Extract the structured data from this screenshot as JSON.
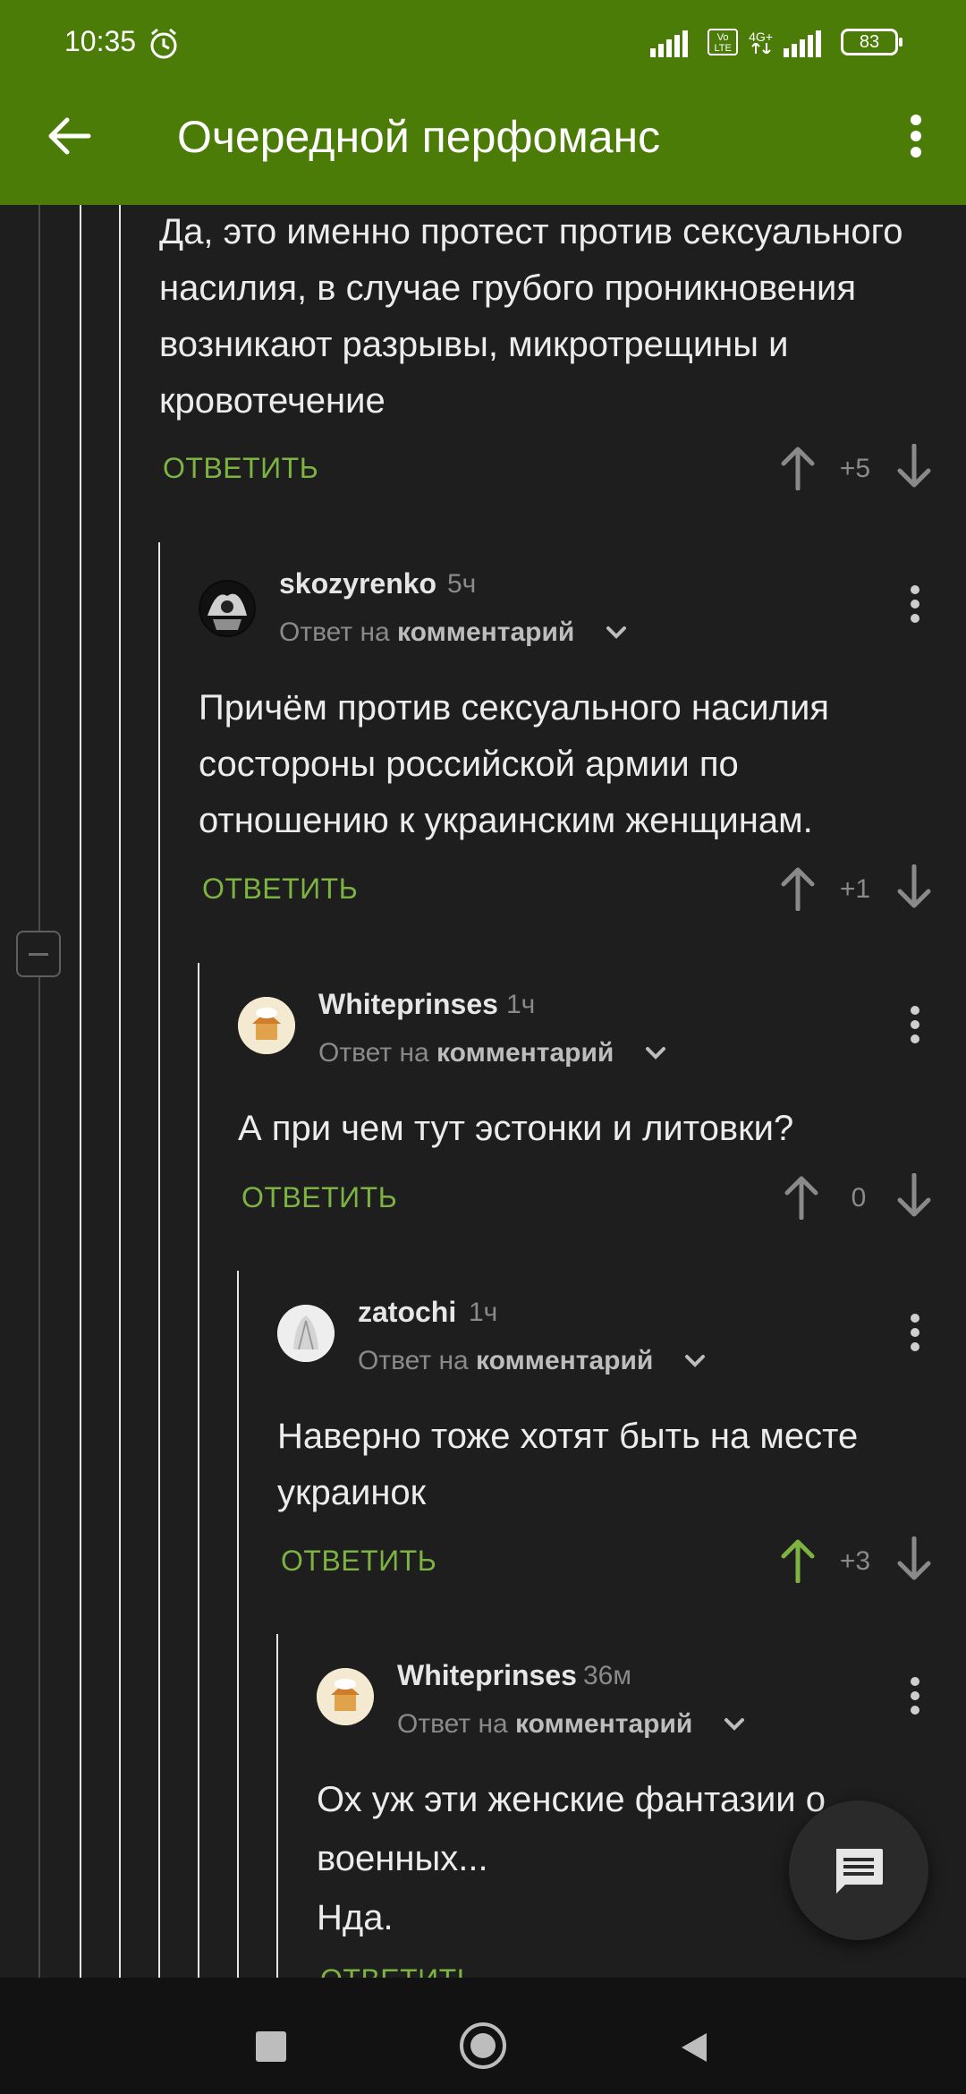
{
  "status": {
    "time": "10:35",
    "battery": "83",
    "volte": "Vo\nLTE",
    "net": "4G+"
  },
  "app_bar": {
    "title": "Очередной перфоманс"
  },
  "comments": [
    {
      "id": "c0",
      "body": "Да, это именно протест против сексуального насилия, в случае грубого проникновения возникают разрывы, микротрещины и кровотечение",
      "reply_label": "ОТВЕТИТЬ",
      "score": "+5",
      "upvoted": false
    },
    {
      "id": "c1",
      "username": "skozyrenko",
      "time": "5ч",
      "reply_prefix": "Ответ на",
      "reply_target": "комментарий",
      "body": "Причём против сексуального насилия состороны российской армии по отношению к украинским женщинам.",
      "reply_label": "ОТВЕТИТЬ",
      "score": "+1",
      "upvoted": false
    },
    {
      "id": "c2",
      "username": "Whiteprinses",
      "time": "1ч",
      "reply_prefix": "Ответ на",
      "reply_target": "комментарий",
      "body": "А при чем тут эстонки и литовки?",
      "reply_label": "ОТВЕТИТЬ",
      "score": "0",
      "upvoted": false
    },
    {
      "id": "c3",
      "username": "zatochi",
      "time": "1ч",
      "reply_prefix": "Ответ на",
      "reply_target": "комментарий",
      "body": "Наверно тоже хотят быть на месте украинок",
      "reply_label": "ОТВЕТИТЬ",
      "score": "+3",
      "upvoted": true
    },
    {
      "id": "c4",
      "username": "Whiteprinses",
      "time": "36м",
      "reply_prefix": "Ответ на",
      "reply_target": "комментарий",
      "body_lines": [
        "Ох уж эти женские фантазии о",
        "военных...",
        "Нда."
      ],
      "reply_label": "ОТВЕТИТЬ"
    }
  ],
  "colors": {
    "header": "#4c7c08",
    "background": "#1e1e1e",
    "accent_green": "#7db341"
  },
  "icons": {
    "back": "arrow-left-icon",
    "menu": "more-vertical-icon",
    "alarm": "alarm-icon",
    "fab": "comment-icon"
  }
}
